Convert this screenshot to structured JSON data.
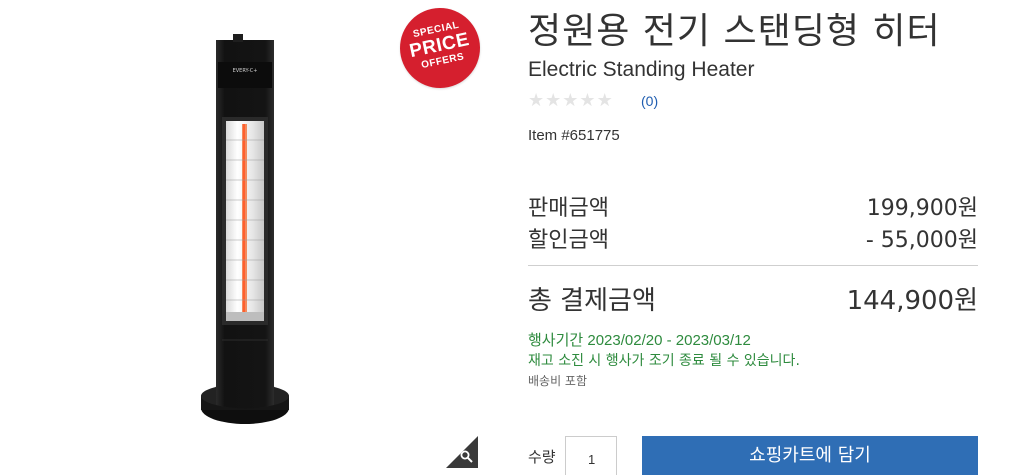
{
  "badge": {
    "line1": "SPECIAL",
    "line2": "PRICE",
    "line3": "OFFERS",
    "color": "#d51f2e"
  },
  "product": {
    "title_ko": "정원용 전기 스탠딩형 히터",
    "title_en": "Electric Standing Heater",
    "rating": {
      "stars": 5,
      "filled": 0,
      "count": "(0)"
    },
    "item_number": "Item #651775",
    "heater_brand_mark": "EVERY-C+"
  },
  "pricing": {
    "sale_label": "판매금액",
    "sale_value": "199,900원",
    "discount_label": "할인금액",
    "discount_value": "- 55,000원",
    "total_label": "총 결제금액",
    "total_value": "144,900원"
  },
  "promo": {
    "period": "행사기간 2023/02/20 - 2023/03/12",
    "note": "재고 소진 시 행사가 조기 종료 될 수 있습니다.",
    "shipping": "배송비 포함",
    "color": "#2e8b3e"
  },
  "purchase": {
    "qty_label": "수량",
    "qty_value": "1",
    "add_to_cart": "쇼핑카트에 담기",
    "button_color": "#2f6eb5"
  },
  "icons": {
    "zoom": "magnifier-icon",
    "star": "star-icon"
  }
}
